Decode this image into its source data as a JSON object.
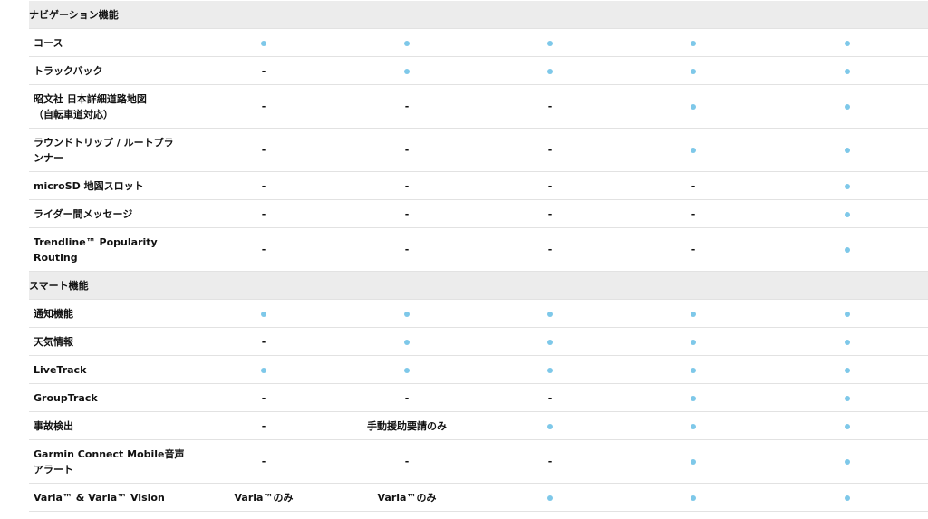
{
  "sections": [
    {
      "title": "ナビゲーション機能",
      "rows": [
        {
          "label": "コース",
          "cells": [
            "dot",
            "dot",
            "dot",
            "dot",
            "dot"
          ]
        },
        {
          "label": "トラックバック",
          "cells": [
            "-",
            "dot",
            "dot",
            "dot",
            "dot"
          ]
        },
        {
          "label": "昭文社 日本詳細道路地図\n（自転車道対応）",
          "cells": [
            "-",
            "-",
            "-",
            "dot",
            "dot"
          ]
        },
        {
          "label": "ラウンドトリップ / ルートプラ\nンナー",
          "cells": [
            "-",
            "-",
            "-",
            "dot",
            "dot"
          ]
        },
        {
          "label": "microSD 地図スロット",
          "cells": [
            "-",
            "-",
            "-",
            "-",
            "dot"
          ]
        },
        {
          "label": "ライダー間メッセージ",
          "cells": [
            "-",
            "-",
            "-",
            "-",
            "dot"
          ]
        },
        {
          "label": "Trendline™ Popularity\nRouting",
          "cells": [
            "-",
            "-",
            "-",
            "-",
            "dot"
          ]
        }
      ]
    },
    {
      "title": "スマート機能",
      "rows": [
        {
          "label": "通知機能",
          "cells": [
            "dot",
            "dot",
            "dot",
            "dot",
            "dot"
          ]
        },
        {
          "label": "天気情報",
          "cells": [
            "-",
            "dot",
            "dot",
            "dot",
            "dot"
          ]
        },
        {
          "label": "LiveTrack",
          "cells": [
            "dot",
            "dot",
            "dot",
            "dot",
            "dot"
          ]
        },
        {
          "label": "GroupTrack",
          "cells": [
            "-",
            "-",
            "-",
            "dot",
            "dot"
          ]
        },
        {
          "label": "事故検出",
          "cells": [
            "-",
            "手動援助要請のみ",
            "dot",
            "dot",
            "dot"
          ]
        },
        {
          "label": "Garmin Connect Mobile音声\nアラート",
          "cells": [
            "-",
            "-",
            "-",
            "dot",
            "dot"
          ]
        },
        {
          "label": "Varia™ & Varia™ Vision",
          "cells": [
            "Varia™のみ",
            "Varia™のみ",
            "dot",
            "dot",
            "dot"
          ]
        }
      ]
    }
  ],
  "colors": {
    "dot": "#7ec8e9",
    "section_bg": "#ececec",
    "divider": "#e2e2e2"
  },
  "icons": {
    "supported": "dot-icon",
    "unsupported": "dash"
  }
}
